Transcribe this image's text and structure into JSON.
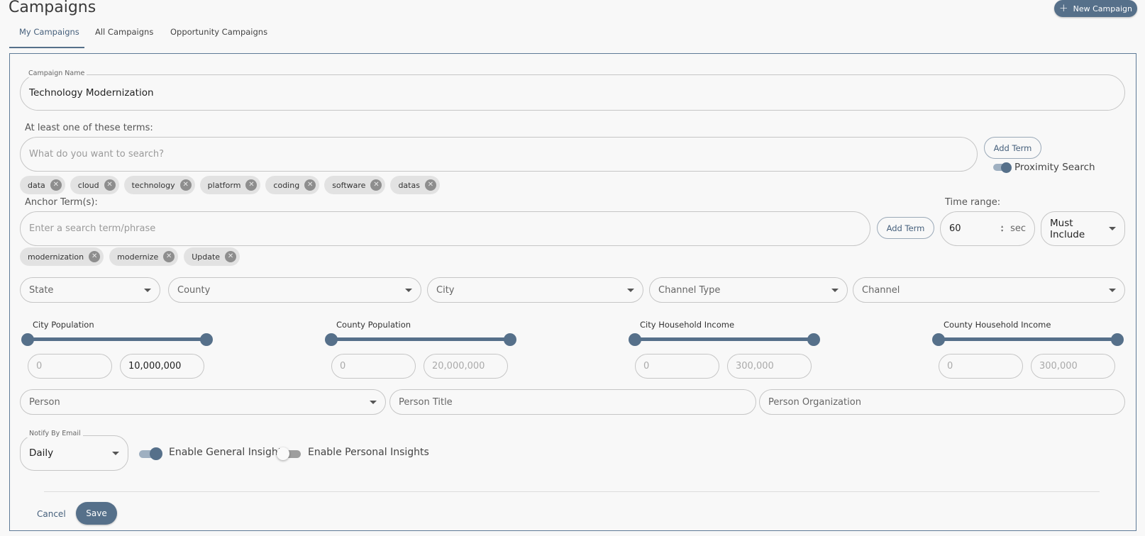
{
  "page": {
    "title": "Campaigns",
    "new_campaign_label": "New Campaign",
    "tabs": [
      "My Campaigns",
      "All Campaigns",
      "Opportunity Campaigns"
    ],
    "active_tab": "My Campaigns"
  },
  "form": {
    "campaign_name": {
      "label": "Campaign Name",
      "value": "Technology Modernization"
    },
    "terms": {
      "label": "At least one of these terms:",
      "placeholder": "What do you want to search?",
      "add_label": "Add Term",
      "chips": [
        "data",
        "cloud",
        "technology",
        "platform",
        "coding",
        "software",
        "datas"
      ],
      "proximity_label": "Proximity Search",
      "proximity_on": true
    },
    "anchor": {
      "label": "Anchor Term(s):",
      "placeholder": "Enter a search term/phrase",
      "add_label": "Add Term",
      "chips": [
        "modernization",
        "modernize",
        "Update"
      ]
    },
    "time_range": {
      "label": "Time range:",
      "value": "60",
      "unit": "sec"
    },
    "include_mode": "Must Include",
    "location_filters": [
      "State",
      "County",
      "City",
      "Channel Type",
      "Channel"
    ],
    "sliders": [
      {
        "label": "City Population",
        "min_placeholder": "0",
        "max_value": "10,000,000",
        "max_filled": true
      },
      {
        "label": "County Population",
        "min_placeholder": "0",
        "max_value": "20,000,000",
        "max_filled": false
      },
      {
        "label": "City Household Income",
        "min_placeholder": "0",
        "max_value": "300,000",
        "max_filled": false
      },
      {
        "label": "County Household Income",
        "min_placeholder": "0",
        "max_value": "300,000",
        "max_filled": false
      }
    ],
    "person": {
      "select": "Person",
      "title": "Person Title",
      "organization": "Person Organization"
    },
    "notify": {
      "label": "Notify By Email",
      "value": "Daily"
    },
    "general_insight": {
      "label": "Enable General Insight",
      "on": true
    },
    "personal_insights": {
      "label": "Enable Personal Insights",
      "on": false
    },
    "cancel_label": "Cancel",
    "save_label": "Save"
  },
  "colors": {
    "accent": "#56708a",
    "chip_bg": "#e2e2e2",
    "border": "#c6c6c6"
  }
}
